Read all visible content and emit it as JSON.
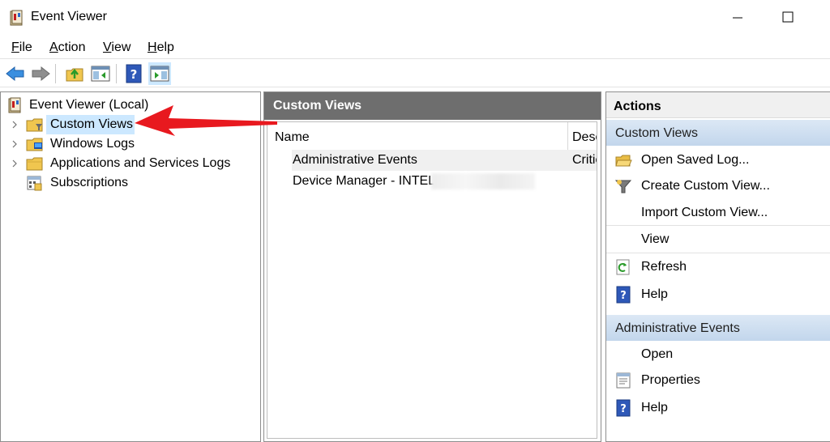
{
  "window": {
    "title": "Event Viewer"
  },
  "menu": [
    {
      "pre": "",
      "key": "F",
      "rest": "ile"
    },
    {
      "pre": "",
      "key": "A",
      "rest": "ction"
    },
    {
      "pre": "",
      "key": "V",
      "rest": "iew"
    },
    {
      "pre": "",
      "key": "H",
      "rest": "elp"
    }
  ],
  "toolbar": {
    "icons": [
      "back-arrow-icon",
      "forward-arrow-icon",
      "up-folder-icon",
      "show-hide-console-tree-icon",
      "help-icon",
      "show-hide-action-pane-icon"
    ]
  },
  "tree": {
    "root": "Event Viewer (Local)",
    "items": [
      {
        "label": "Custom Views",
        "selected": true
      },
      {
        "label": "Windows Logs"
      },
      {
        "label": "Applications and Services Logs"
      },
      {
        "label": "Subscriptions"
      }
    ]
  },
  "middle": {
    "header": "Custom Views",
    "columns": [
      "Name",
      "Desc"
    ],
    "rows": [
      {
        "name": "Administrative Events",
        "desc": "Critic"
      },
      {
        "name": "Device Manager - INTEL",
        "desc": ""
      }
    ]
  },
  "actions": {
    "title": "Actions",
    "section1": {
      "title": "Custom Views",
      "items": [
        "Open Saved Log...",
        "Create Custom View...",
        "Import Custom View...",
        "View",
        "Refresh",
        "Help"
      ]
    },
    "section2": {
      "title": "Administrative Events",
      "items": [
        "Open",
        "Properties",
        "Help"
      ]
    }
  },
  "colors": {
    "accent_selection": "#cce8ff",
    "pane_header": "#6e6e6e",
    "section_header": "#c9dcef",
    "annotation_arrow": "#e8191f"
  }
}
